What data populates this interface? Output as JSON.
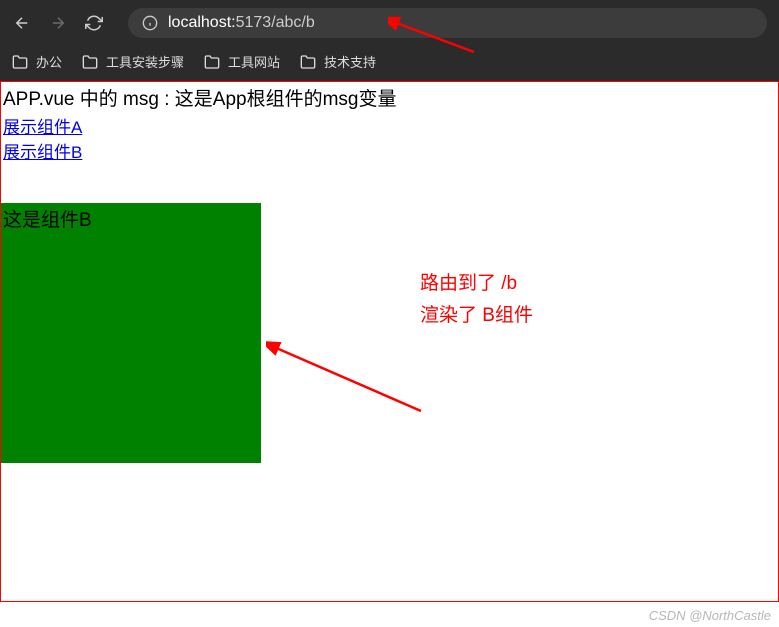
{
  "browser": {
    "url_host": "localhost:",
    "url_port_path": "5173/abc/b"
  },
  "bookmarks": [
    {
      "label": "办公"
    },
    {
      "label": "工具安装步骤"
    },
    {
      "label": "工具网站"
    },
    {
      "label": "技术支持"
    }
  ],
  "page": {
    "msg": "APP.vue 中的 msg : 这是App根组件的msg变量",
    "linkA": "展示组件A",
    "linkB": "展示组件B",
    "componentB_label": "这是组件B"
  },
  "annotation": {
    "line1": "路由到了 /b",
    "line2": "渲染了 B组件"
  },
  "watermark": "CSDN @NorthCastle"
}
